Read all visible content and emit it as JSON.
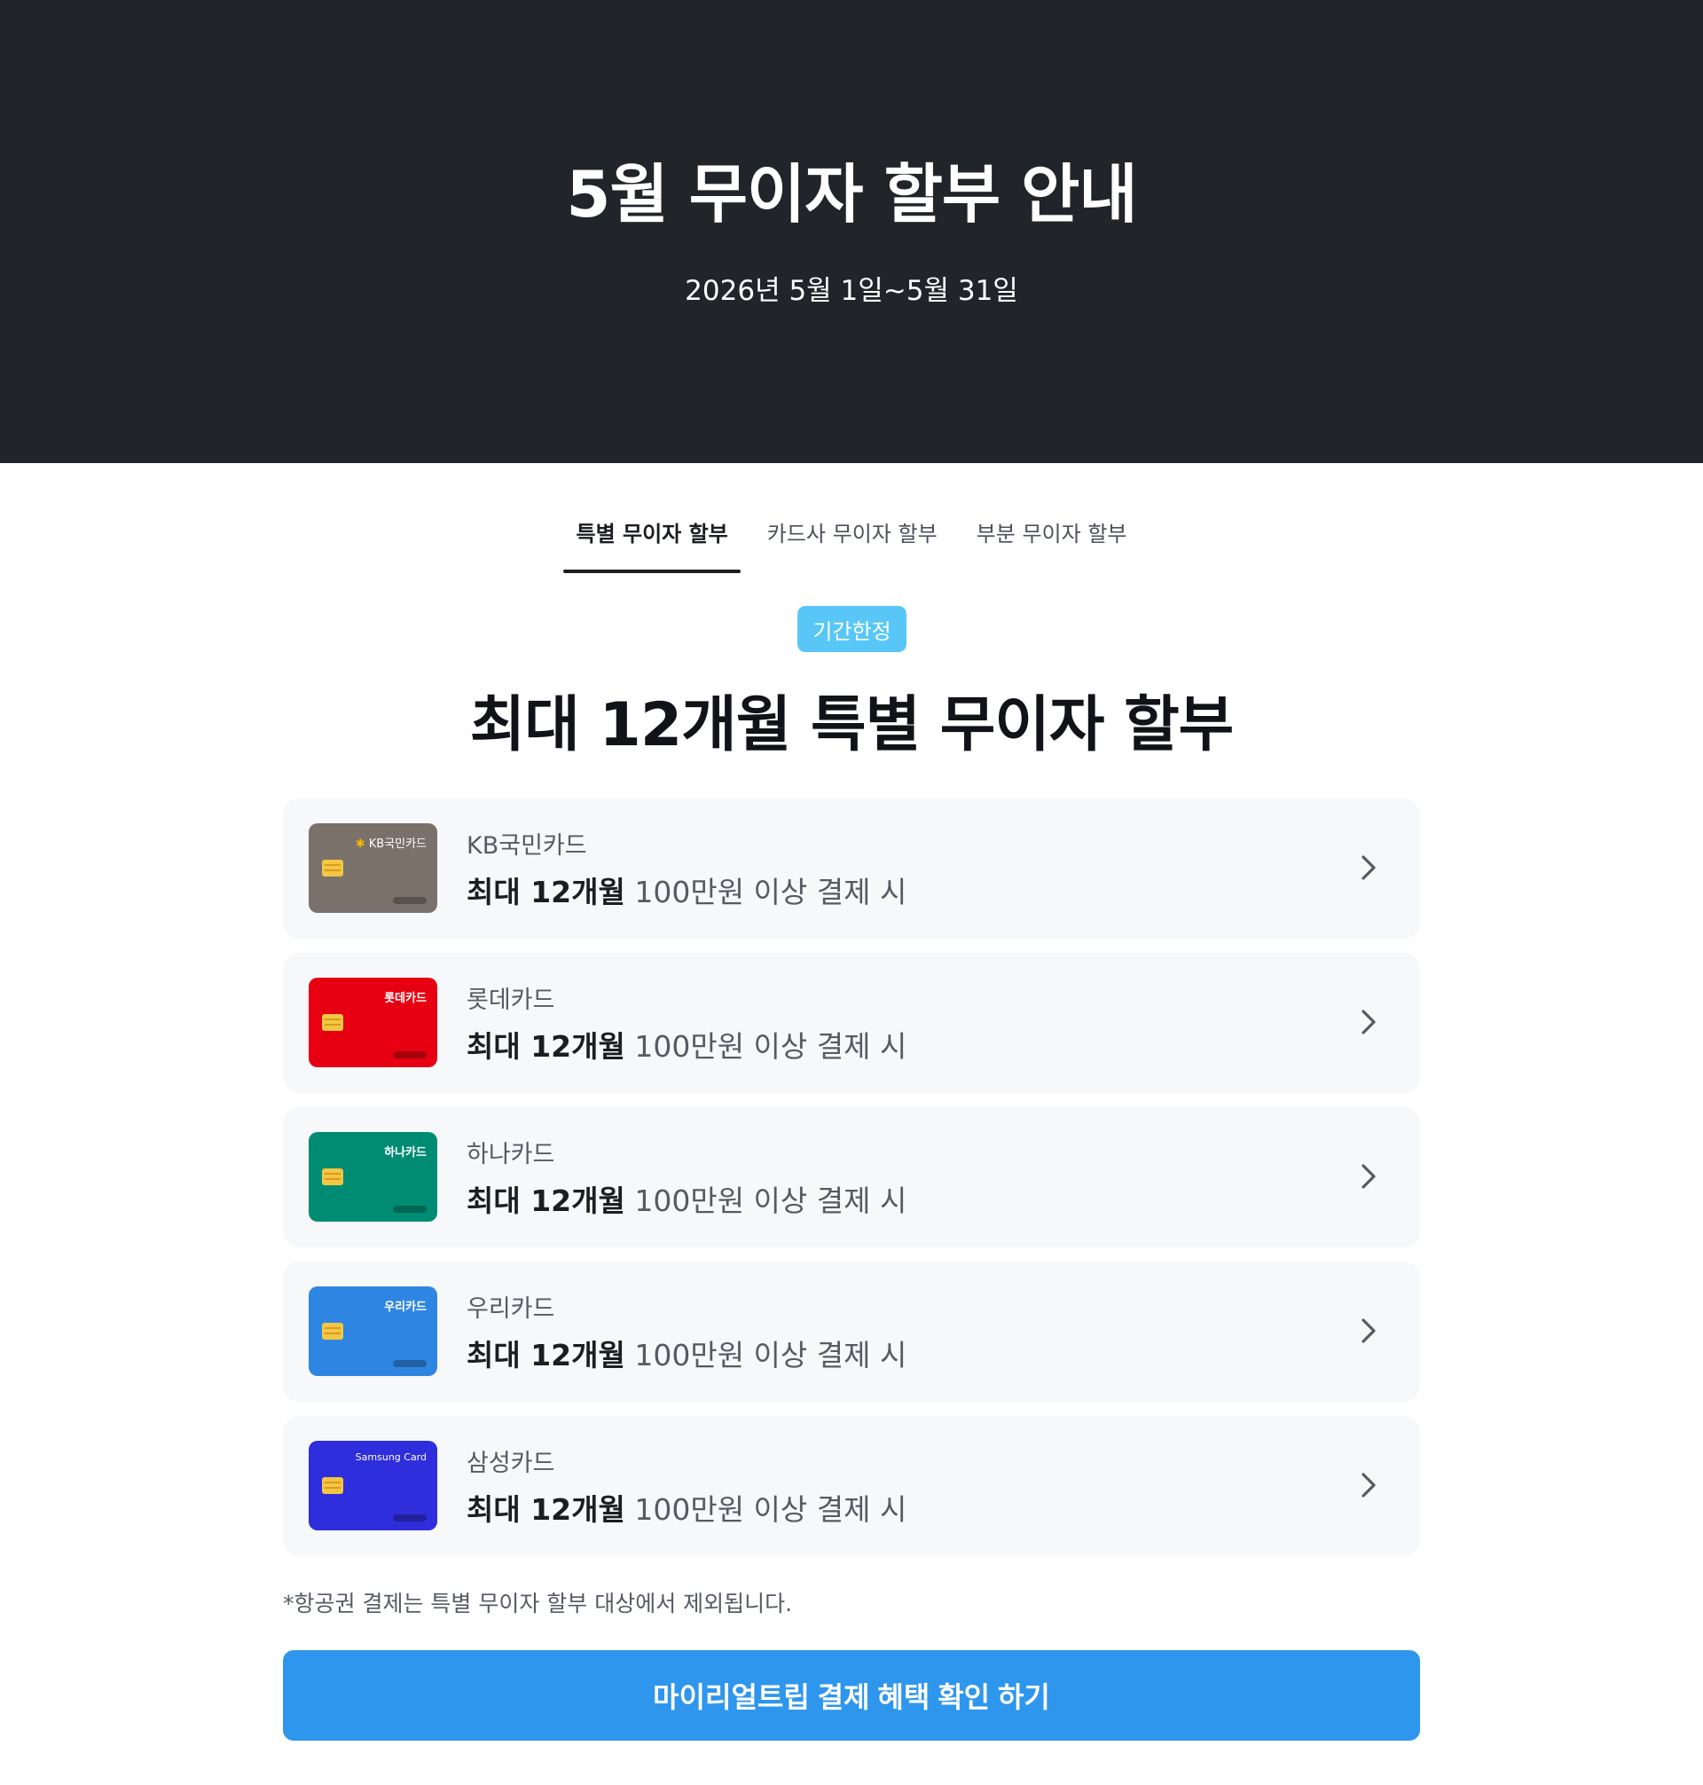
{
  "hero": {
    "title": "5월 무이자 할부 안내",
    "period": "2026년 5월 1일~5월 31일"
  },
  "tabs": [
    {
      "label": "특별 무이자 할부",
      "active": true
    },
    {
      "label": "카드사 무이자 할부",
      "active": false
    },
    {
      "label": "부분 무이자 할부",
      "active": false
    }
  ],
  "badge": "기간한정",
  "main_title": "최대 12개월 특별 무이자 할부",
  "cards": [
    {
      "name": "KB국민카드",
      "brand": "KB국민카드",
      "color": "#7a716a",
      "months": "최대 12개월",
      "condition": "100만원 이상 결제 시"
    },
    {
      "name": "롯데카드",
      "brand": "롯데카드",
      "color": "#e60012",
      "months": "최대 12개월",
      "condition": "100만원 이상 결제 시"
    },
    {
      "name": "하나카드",
      "brand": "하나카드",
      "color": "#008c73",
      "months": "최대 12개월",
      "condition": "100만원 이상 결제 시"
    },
    {
      "name": "우리카드",
      "brand": "우리카드",
      "color": "#2f86e2",
      "months": "최대 12개월",
      "condition": "100만원 이상 결제 시"
    },
    {
      "name": "삼성카드",
      "brand": "Samsung Card",
      "color": "#2e2edc",
      "months": "최대 12개월",
      "condition": "100만원 이상 결제 시"
    }
  ],
  "footnote": "*항공권 결제는 특별 무이자 할부 대상에서 제외됩니다.",
  "cta_label": "마이리얼트립 결제 혜택 확인 하기",
  "colors": {
    "hero_bg": "#212429",
    "badge": "#58c7f7",
    "cta": "#2e96ec",
    "row_bg": "#f7f8fa"
  }
}
